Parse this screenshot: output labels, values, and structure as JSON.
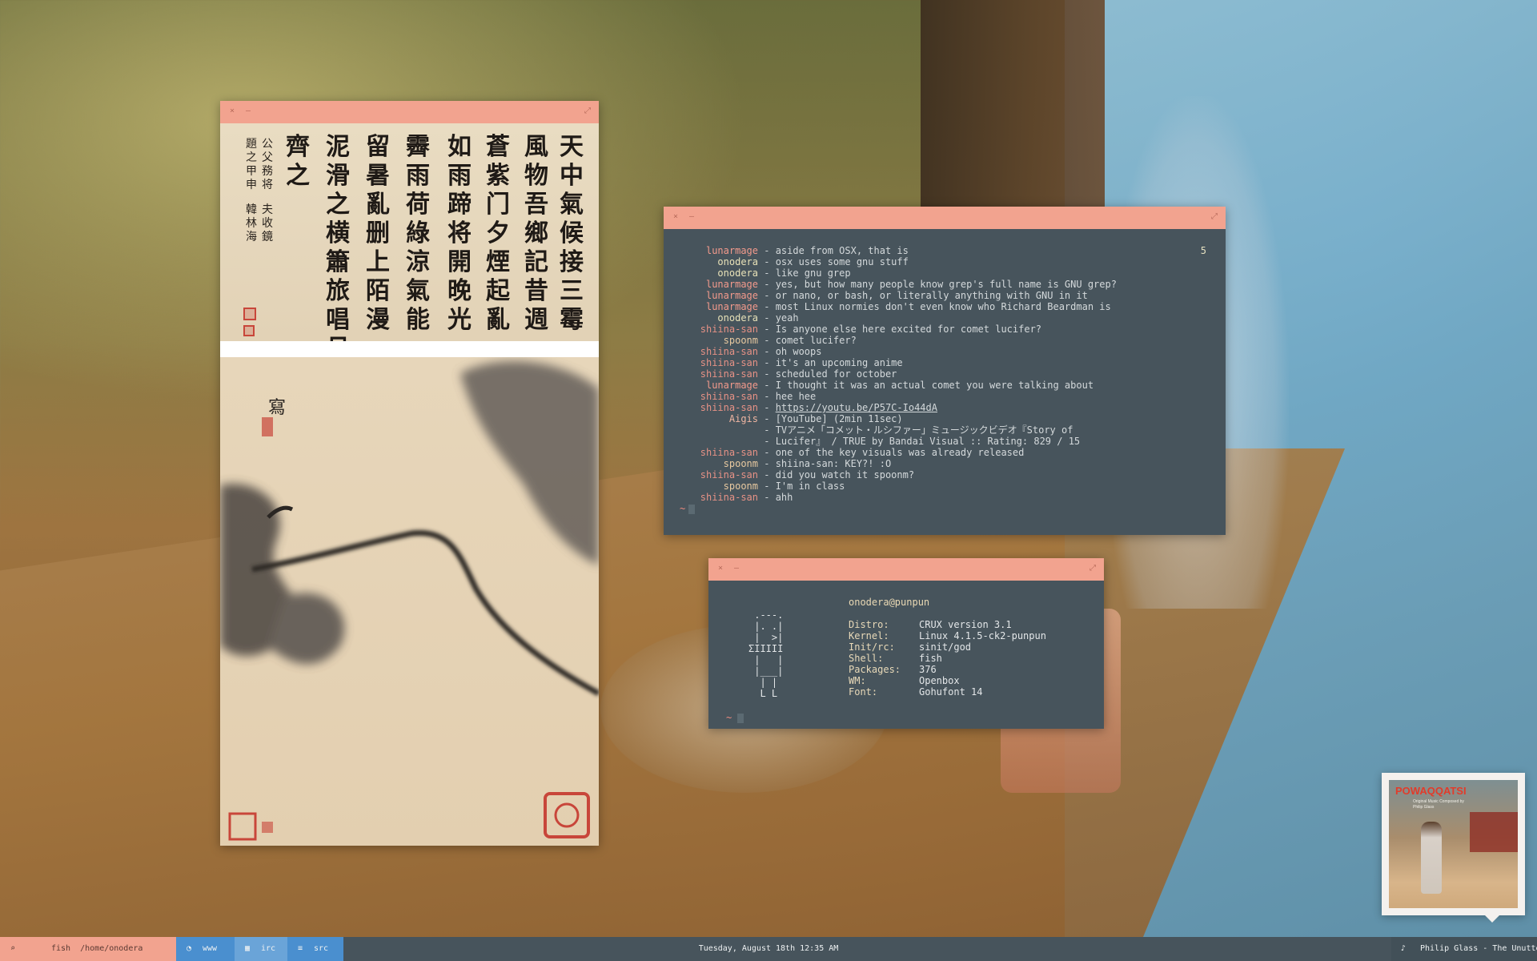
{
  "irc": {
    "count": "5",
    "lines": [
      {
        "nick": "lunarmage",
        "msg": "aside from OSX, that is"
      },
      {
        "nick": "onodera",
        "msg": "osx uses some gnu stuff"
      },
      {
        "nick": "onodera",
        "msg": "like gnu grep"
      },
      {
        "nick": "lunarmage",
        "msg": "yes, but how many people know grep's full name is GNU grep?"
      },
      {
        "nick": "lunarmage",
        "msg": "or nano, or bash, or literally anything with GNU in it"
      },
      {
        "nick": "lunarmage",
        "msg": "most Linux normies don't even know who Richard Beardman is"
      },
      {
        "nick": "onodera",
        "msg": "yeah"
      },
      {
        "nick": "shiina-san",
        "msg": "Is anyone else here excited for comet lucifer?"
      },
      {
        "nick": "spoonm",
        "msg": "comet lucifer?"
      },
      {
        "nick": "shiina-san",
        "msg": "oh woops"
      },
      {
        "nick": "shiina-san",
        "msg": "it's an upcoming anime"
      },
      {
        "nick": "shiina-san",
        "msg": "scheduled for october"
      },
      {
        "nick": "lunarmage",
        "msg": "I thought it was an actual comet you were talking about"
      },
      {
        "nick": "shiina-san",
        "msg": "hee hee"
      },
      {
        "nick": "shiina-san",
        "msg": "https://youtu.be/P57C-Io44dA"
      },
      {
        "nick": "Aigis",
        "msg": "[YouTube] (2min 11sec)"
      },
      {
        "nick": "",
        "msg": "TVアニメ「コメット・ルシファー」ミュージックビデオ『Story of"
      },
      {
        "nick": "",
        "msg": "Lucifer』 / TRUE by Bandai Visual :: Rating: 829 / 15"
      },
      {
        "nick": "shiina-san",
        "msg": "one of the key visuals was already released"
      },
      {
        "nick": "spoonm",
        "msg": "shiina-san: KEY?! :O"
      },
      {
        "nick": "shiina-san",
        "msg": "did you watch it spoonm?"
      },
      {
        "nick": "spoonm",
        "msg": "I'm in class"
      },
      {
        "nick": "shiina-san",
        "msg": "ahh"
      }
    ],
    "prompt": "~"
  },
  "fetch": {
    "user_host": "onodera@punpun",
    "ascii": " .---.\n |. .|\n |  >|\nΣIIIII\n |   |\n |___|\n  | |\n  L L",
    "rows": [
      {
        "key": "Distro:",
        "val": "CRUX version 3.1"
      },
      {
        "key": "Kernel:",
        "val": "Linux 4.1.5-ck2-punpun"
      },
      {
        "key": "Init/rc:",
        "val": "sinit/god"
      },
      {
        "key": "Shell:",
        "val": "fish"
      },
      {
        "key": "Packages:",
        "val": "376"
      },
      {
        "key": "WM:",
        "val": "Openbox"
      },
      {
        "key": "Font:",
        "val": "Gohufont 14"
      }
    ],
    "prompt": "~"
  },
  "window_buttons": {
    "close": "×",
    "minimize": "–",
    "maximize": "⤢"
  },
  "calligraphy": {
    "columns": [
      "天中氣候接三霉",
      "風物吾鄉記昔週",
      "蒼紫门夕煙起亂",
      "如雨蹄将開晚光",
      "霽雨荷綠涼氣能",
      "留暑亂删上陌漫",
      "泥滑之横簫旅唱月",
      "齊之"
    ],
    "inscription": [
      "公父務将",
      "題之甲申",
      "夫收鏡",
      "韓林海"
    ]
  },
  "taskbar": {
    "shell": {
      "icon": "⌕",
      "text": "fish  /home/onodera"
    },
    "workspaces": [
      {
        "icon": "◔",
        "label": "www"
      },
      {
        "icon": "▦",
        "label": "irc"
      },
      {
        "icon": "≡",
        "label": "src"
      }
    ],
    "clock": "Tuesday, August 18th 12:35 AM",
    "now_playing": {
      "icon": "♪",
      "text": "Philip Glass - The Unutterable"
    }
  },
  "album": {
    "title": "POWAQQATSI",
    "subtitle": "Original Music Composed by\nPhilip Glass"
  },
  "colors": {
    "accent": "#f2a38f",
    "terminal_bg": "#47545c",
    "workspace_active": "#6aa4d8",
    "workspace": "#4a8fcf"
  }
}
